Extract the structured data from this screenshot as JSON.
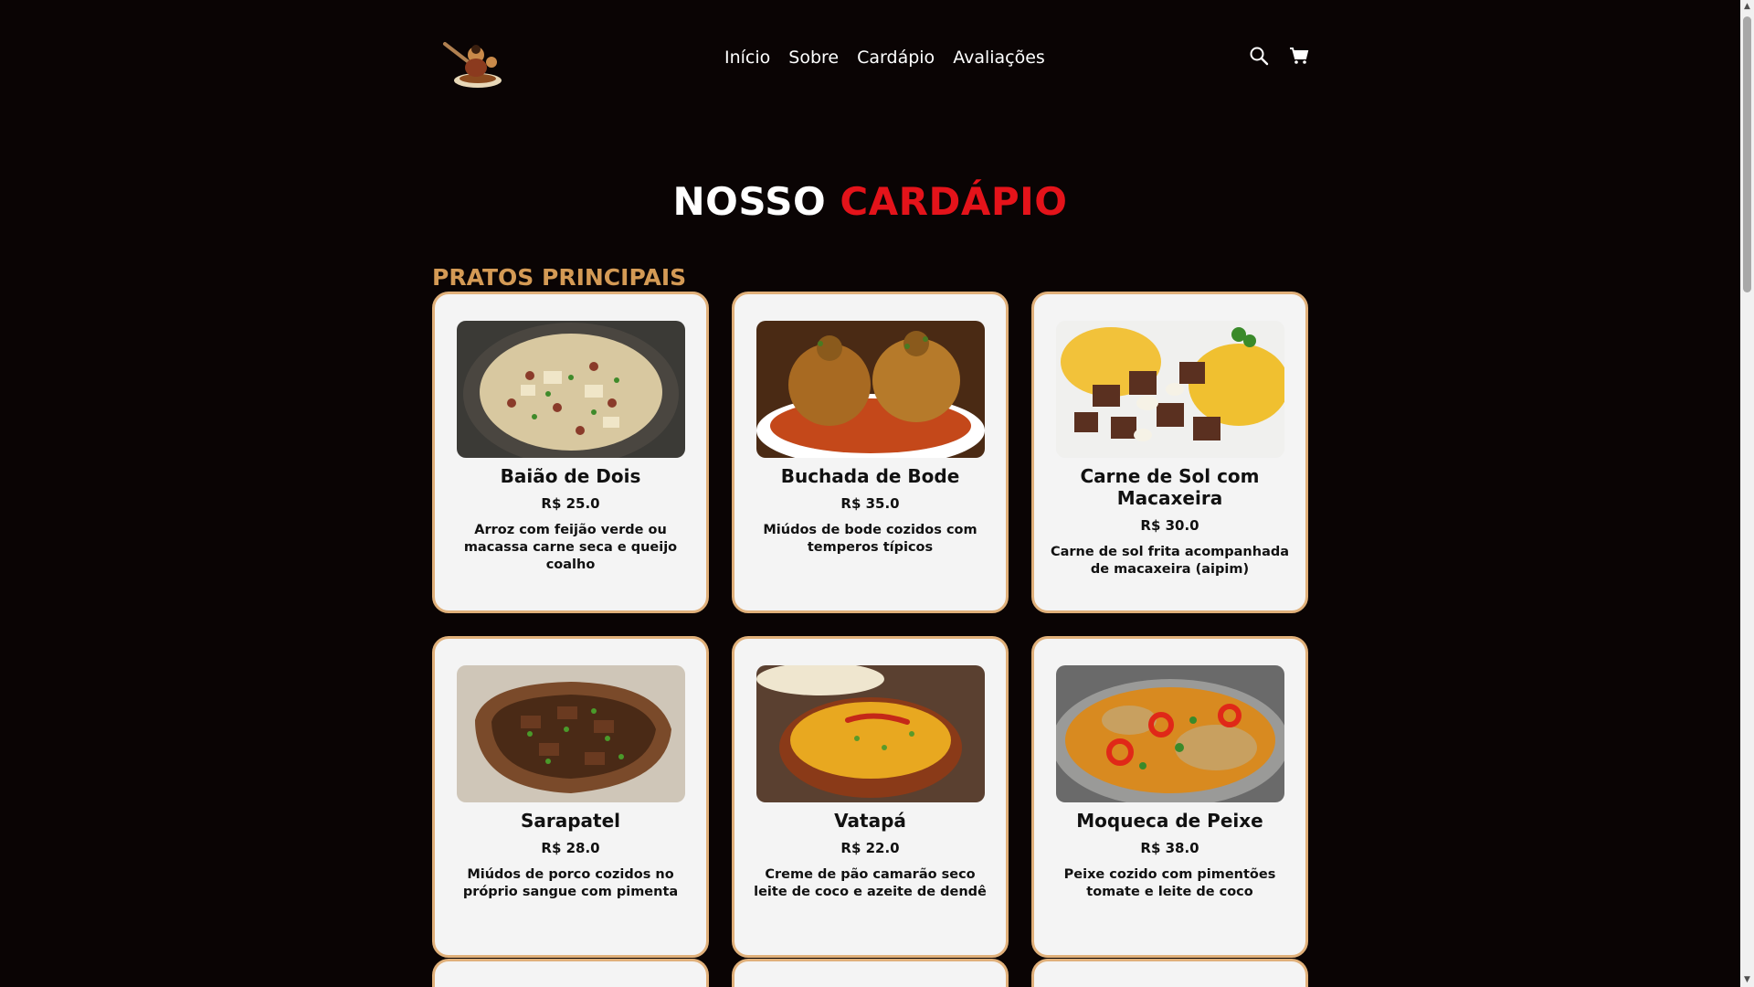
{
  "nav": {
    "items": [
      {
        "label": "Início"
      },
      {
        "label": "Sobre"
      },
      {
        "label": "Cardápio"
      },
      {
        "label": "Avaliações"
      }
    ],
    "icons": [
      "search-icon",
      "cart-icon"
    ]
  },
  "title": {
    "part1": "NOSSO",
    "part2": "CARDÁPIO"
  },
  "section": {
    "title": "PRATOS PRINCIPAIS"
  },
  "colors": {
    "background": "#0a0404",
    "accent_red": "#e4131a",
    "section_gold": "#d49a55",
    "card_border": "#e0b07a"
  },
  "items": [
    {
      "name": "Baião de Dois",
      "price": "R$ 25.0",
      "desc": "Arroz com feijão verde ou macassa carne seca e queijo coalho"
    },
    {
      "name": "Buchada de Bode",
      "price": "R$ 35.0",
      "desc": "Miúdos de bode cozidos com temperos típicos"
    },
    {
      "name": "Carne de Sol com Macaxeira",
      "price": "R$ 30.0",
      "desc": "Carne de sol frita acompanhada de macaxeira (aipim)"
    },
    {
      "name": "Sarapatel",
      "price": "R$ 28.0",
      "desc": "Miúdos de porco cozidos no próprio sangue com pimenta"
    },
    {
      "name": "Vatapá",
      "price": "R$ 22.0",
      "desc": "Creme de pão camarão seco leite de coco e azeite de dendê"
    },
    {
      "name": "Moqueca de Peixe",
      "price": "R$ 38.0",
      "desc": "Peixe cozido com pimentões tomate e leite de coco"
    }
  ]
}
